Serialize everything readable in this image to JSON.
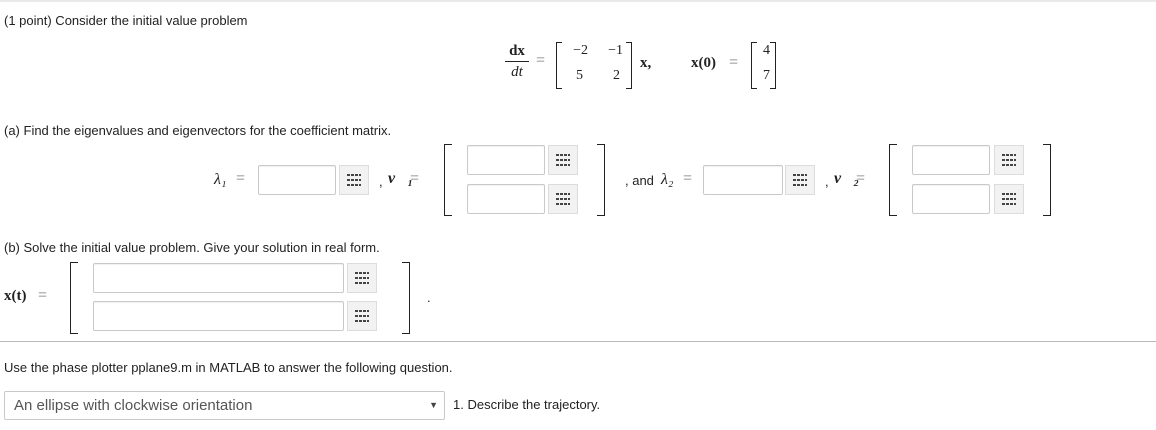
{
  "header": {
    "points": "(1 point) Consider the initial value problem"
  },
  "ivp": {
    "frac_num": "dx",
    "frac_den": "dt",
    "eq": "=",
    "matrix": [
      [
        "−2",
        "−1"
      ],
      [
        "5",
        "2"
      ]
    ],
    "x_vec": "x,",
    "ic_label": "x(0)",
    "ic_eq": "=",
    "ic_vector": [
      "4",
      "7"
    ]
  },
  "part_a": {
    "prompt": "(a) Find the eigenvalues and eigenvectors for the coefficient matrix.",
    "lambda1": "λ₁",
    "eq": "=",
    "comma_v1": ",",
    "v1": "v⃗₁",
    "and_text": ", and",
    "lambda2": "λ₂",
    "comma_v2": ",",
    "v2": "v⃗₂",
    "values": {
      "lambda1": "",
      "lambda2": "",
      "v1_top": "",
      "v1_bottom": "",
      "v2_top": "",
      "v2_bottom": ""
    }
  },
  "part_b": {
    "prompt": "(b) Solve the initial value problem. Give your solution in real form.",
    "xt": "x(t)",
    "eq": "=",
    "period": ".",
    "values": {
      "top": "",
      "bottom": ""
    }
  },
  "phase": {
    "instruction": "Use the phase plotter pplane9.m in MATLAB to answer the following question.",
    "selected_option": "An ellipse with clockwise orientation",
    "question": "1. Describe the trajectory."
  },
  "icons": {
    "math_editor": "grid-icon",
    "dropdown": "caret-down-icon"
  }
}
